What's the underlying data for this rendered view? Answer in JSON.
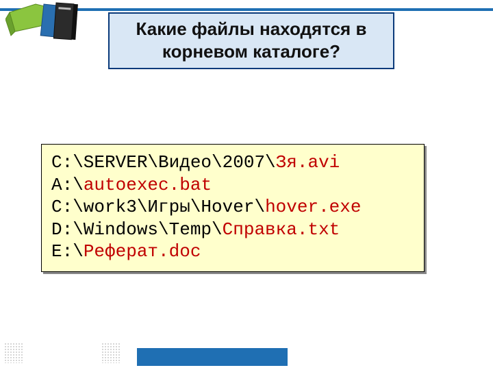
{
  "title": {
    "line1": "Какие файлы  находятся в",
    "line2": "корневом  каталоге?"
  },
  "rows": [
    {
      "segments": [
        {
          "text": "C:\\SERVER\\Видео\\2007\\",
          "hl": false
        },
        {
          "text": "Зя.avi",
          "hl": true
        }
      ]
    },
    {
      "segments": [
        {
          "text": "A:\\",
          "hl": false
        },
        {
          "text": "autoexec.bat",
          "hl": true
        }
      ]
    },
    {
      "segments": [
        {
          "text": "C:\\work3\\Игры\\Hover\\",
          "hl": false
        },
        {
          "text": "hover.exe",
          "hl": true
        }
      ]
    },
    {
      "segments": [
        {
          "text": "D:\\Windows\\Temp\\",
          "hl": false
        },
        {
          "text": "Справка.txt",
          "hl": true
        }
      ]
    },
    {
      "segments": [
        {
          "text": "E:\\",
          "hl": false
        },
        {
          "text": "Реферат.doc",
          "hl": true
        }
      ]
    }
  ]
}
